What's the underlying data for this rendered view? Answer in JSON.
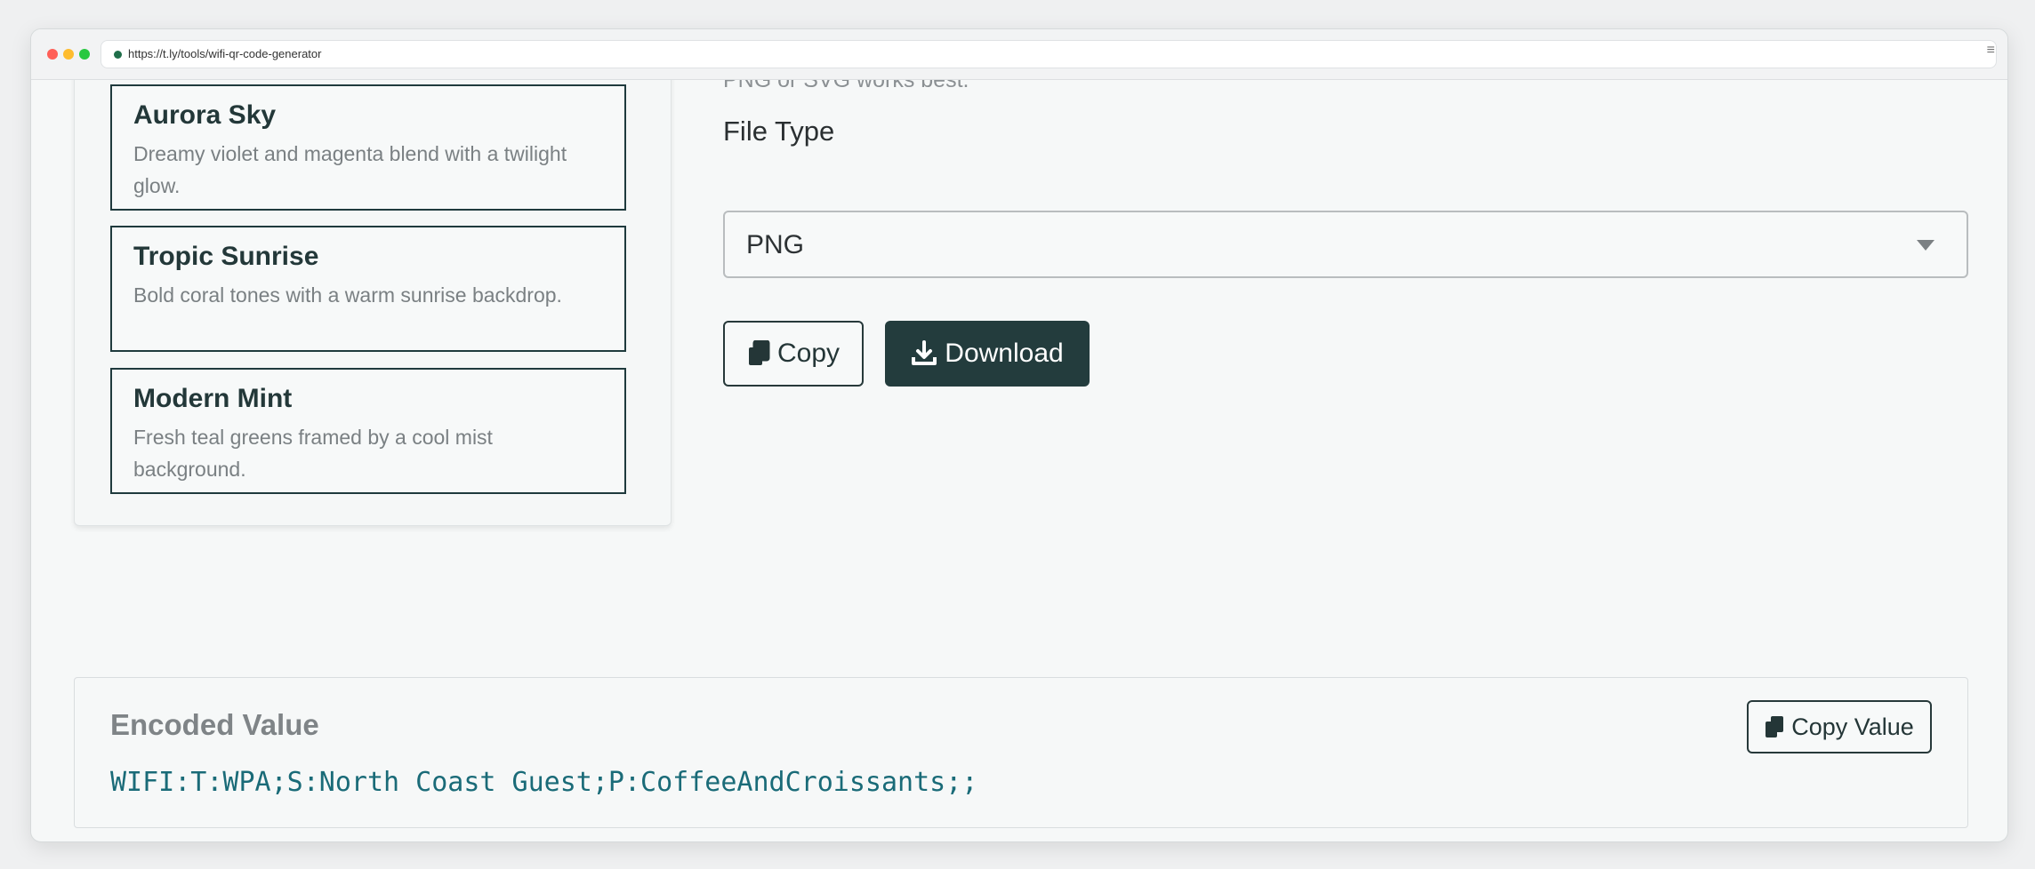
{
  "browser": {
    "url": "https://t.ly/tools/wifi-qr-code-generator"
  },
  "themes": [
    {
      "title": "Aurora Sky",
      "description": "Dreamy violet and magenta blend with a twilight glow."
    },
    {
      "title": "Tropic Sunrise",
      "description": "Bold coral tones with a warm sunrise backdrop."
    },
    {
      "title": "Modern Mint",
      "description": "Fresh teal greens framed by a cool mist background."
    }
  ],
  "export": {
    "hint_text": "PNG or SVG works best.",
    "file_type_label": "File Type",
    "file_type_selected": "PNG",
    "copy_label": "Copy",
    "download_label": "Download"
  },
  "encoded": {
    "title": "Encoded Value",
    "value": "WIFI:T:WPA;S:North Coast Guest;P:CoffeeAndCroissants;;",
    "copy_value_label": "Copy Value"
  },
  "colors": {
    "primary_dark": "#233c3d",
    "encoded_text": "#1a6b78"
  }
}
